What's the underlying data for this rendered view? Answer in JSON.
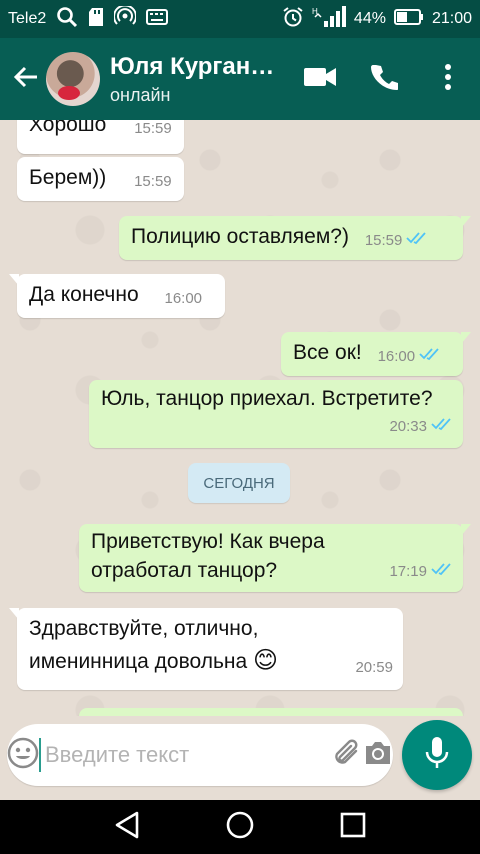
{
  "status_bar": {
    "carrier": "Tele2",
    "battery": "44%",
    "time": "21:00"
  },
  "header": {
    "contact_name": "Юля Курган…",
    "status": "онлайн"
  },
  "messages": [
    {
      "direction": "in",
      "text": "Хорошо",
      "time": "15:59"
    },
    {
      "direction": "in",
      "text": "Берем))",
      "time": "15:59"
    },
    {
      "direction": "out",
      "text": "Полицию оставляем?)",
      "time": "15:59",
      "read": true
    },
    {
      "direction": "in",
      "text": "Да конечно",
      "time": "16:00"
    },
    {
      "direction": "out",
      "text": "Все ок!",
      "time": "16:00",
      "read": true
    },
    {
      "direction": "out",
      "text": "Юль, танцор приехал. Встретите?",
      "time": "20:33",
      "read": true
    },
    {
      "direction": "out",
      "text_line1": "Приветствую! Как вчера",
      "text_line2": "отработал танцор?",
      "time": "17:19",
      "read": true
    },
    {
      "direction": "in",
      "text_line1": "Здравствуйте, отлично,",
      "text_line2": "именинница довольна",
      "emoji": "😊",
      "time": "20:59"
    }
  ],
  "date_divider": "СЕГОДНЯ",
  "composer": {
    "placeholder": "Введите текст"
  },
  "colors": {
    "header": "#075e54",
    "status_bar": "#054d44",
    "outgoing_bubble": "#dcf8c6",
    "incoming_bubble": "#ffffff",
    "read_ticks": "#4fc3f7",
    "mic_button": "#00897b"
  },
  "icons": {
    "status": [
      "search-icon",
      "sd-card-icon",
      "hotspot-icon",
      "keyboard-icon",
      "alarm-icon",
      "signal-icon",
      "battery-icon"
    ],
    "header": [
      "back-arrow-icon",
      "video-call-icon",
      "phone-icon",
      "more-vert-icon"
    ],
    "composer": [
      "emoji-icon",
      "attach-icon",
      "camera-icon",
      "mic-icon"
    ],
    "nav": [
      "back-triangle-icon",
      "home-circle-icon",
      "recents-square-icon"
    ]
  }
}
